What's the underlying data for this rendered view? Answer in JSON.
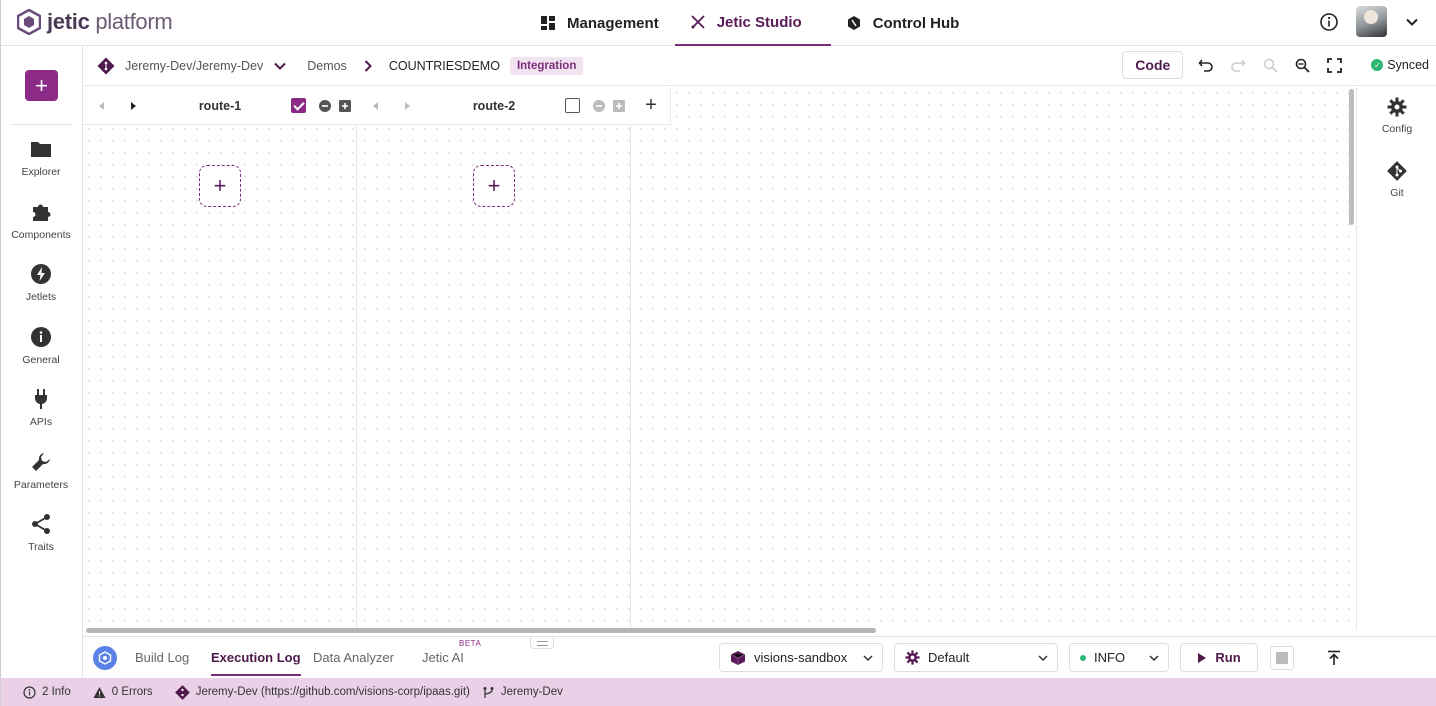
{
  "brand": {
    "bold": "jetic",
    "light": "platform"
  },
  "top_nav": [
    {
      "label": "Management",
      "icon": "dashboard-icon"
    },
    {
      "label": "Jetic Studio",
      "icon": "tools-icon",
      "active": true
    },
    {
      "label": "Control Hub",
      "icon": "hub-icon"
    }
  ],
  "sidebar": {
    "add_label": "+",
    "items": [
      {
        "label": "Explorer",
        "icon": "folder-icon"
      },
      {
        "label": "Components",
        "icon": "puzzle-icon"
      },
      {
        "label": "Jetlets",
        "icon": "bolt-icon"
      },
      {
        "label": "General",
        "icon": "info-icon"
      },
      {
        "label": "APIs",
        "icon": "plug-icon"
      },
      {
        "label": "Parameters",
        "icon": "wrench-icon"
      },
      {
        "label": "Traits",
        "icon": "share-icon"
      }
    ]
  },
  "breadcrumb": {
    "repo": "Jeremy-Dev/Jeremy-Dev",
    "folder": "Demos",
    "project": "COUNTRIESDEMO",
    "tag": "Integration"
  },
  "toolbar": {
    "code_label": "Code",
    "sync_status": "Synced"
  },
  "routes": [
    {
      "name": "route-1",
      "selected": true,
      "add": "+"
    },
    {
      "name": "route-2",
      "selected": false,
      "add": "+"
    }
  ],
  "add_route_label": "+",
  "right_panel": [
    {
      "label": "Config",
      "icon": "gear-icon"
    },
    {
      "label": "Git",
      "icon": "git-icon"
    }
  ],
  "bottom_panel": {
    "tabs": [
      {
        "label": "Build Log",
        "active": false
      },
      {
        "label": "Execution Log",
        "active": true
      },
      {
        "label": "Data Analyzer",
        "active": false
      },
      {
        "label": "Jetic AI",
        "active": false
      }
    ],
    "beta_label": "BETA",
    "environment": "visions-sandbox",
    "profile": "Default",
    "log_level": "INFO",
    "run_label": "Run"
  },
  "status_bar": {
    "info": "2 Info",
    "errors": "0 Errors",
    "repo": "Jeremy-Dev (https://github.com/visions-corp/ipaas.git)",
    "branch": "Jeremy-Dev"
  },
  "colors": {
    "brand": "#8b2a87",
    "brand_dark": "#4d1a4b",
    "status_bar": "#ead1e8",
    "synced": "#2bb673"
  }
}
